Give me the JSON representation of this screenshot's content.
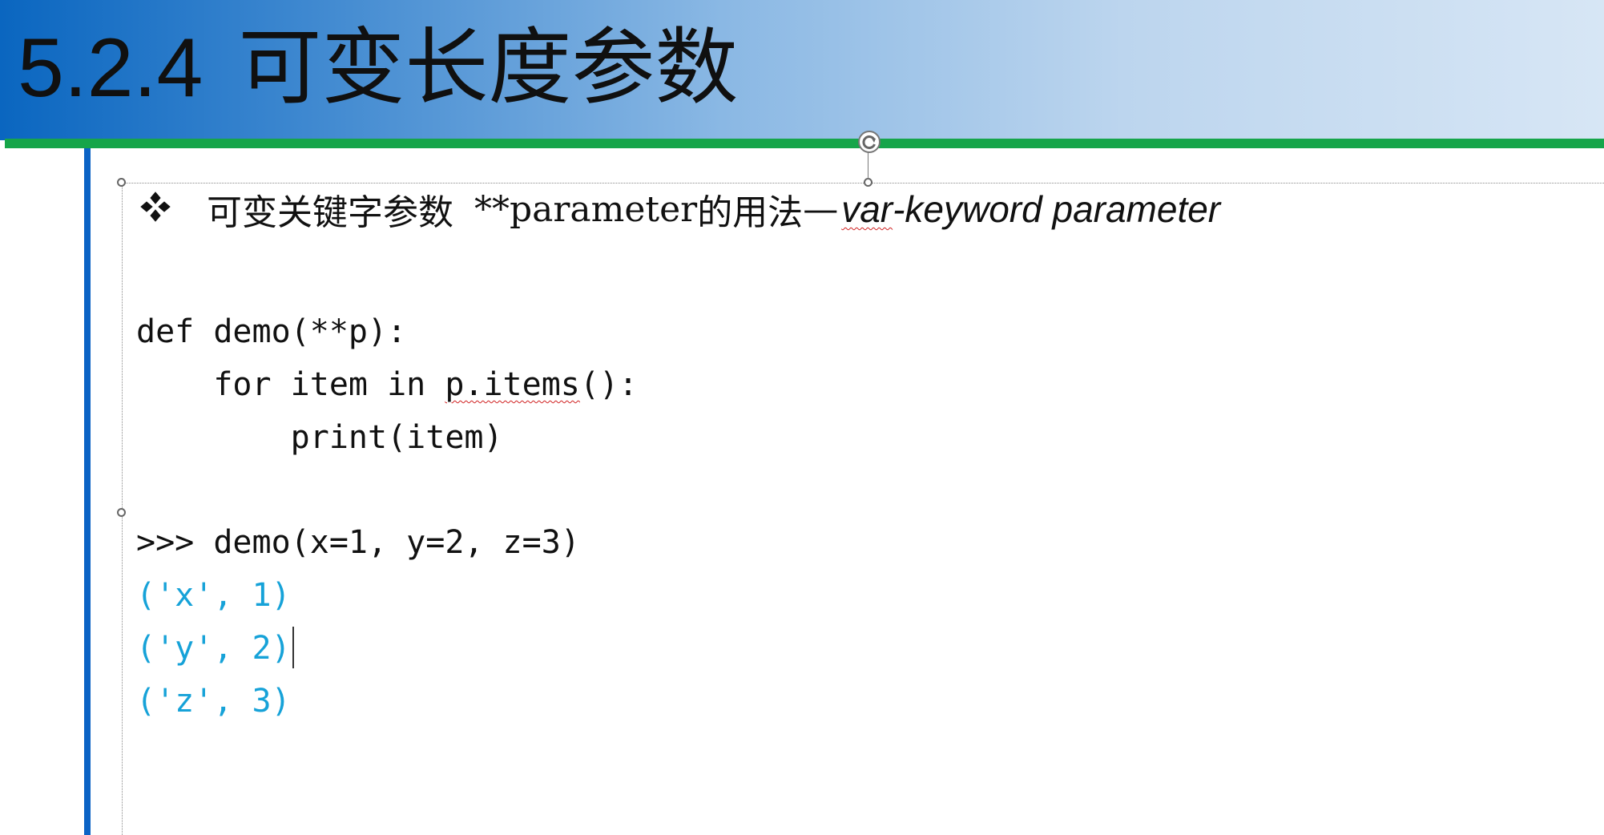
{
  "slide": {
    "title_number": "5.2.4",
    "title_text": "可变长度参数"
  },
  "bullet": {
    "icon": "four-diamond-bullet-icon",
    "heading_cn": "可变关键字参数",
    "heading_code": "**parameter",
    "heading_suffix": "的用法",
    "heading_dash": "—",
    "heading_italic_flagged": "var",
    "heading_italic_rest": "-keyword parameter"
  },
  "code": {
    "definition": [
      "def demo(**p):",
      "    for item in p.items():",
      "        print(item)"
    ],
    "call": ">>> demo(x=1, y=2, z=3)",
    "output": [
      "('x', 1)",
      "('y', 2)",
      "('z', 3)"
    ]
  },
  "colors": {
    "title_band_start": "#0a66c0",
    "title_band_end": "#d7e6f5",
    "green_rule": "#16a54a",
    "blue_rule": "#0b63c5",
    "output_text": "#16a2d8",
    "spellcheck_underline": "#d02020"
  }
}
